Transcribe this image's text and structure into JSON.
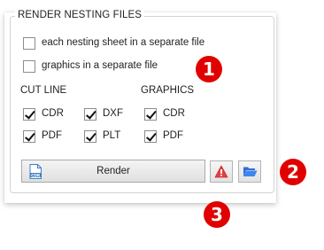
{
  "group": {
    "title": "RENDER NESTING FILES"
  },
  "options": [
    {
      "label": "each nesting sheet in a separate file",
      "checked": false
    },
    {
      "label": "graphics in a separate file",
      "checked": false
    }
  ],
  "cut_line": {
    "heading": "CUT LINE",
    "items": [
      {
        "label": "CDR",
        "checked": true
      },
      {
        "label": "DXF",
        "checked": true
      },
      {
        "label": "PDF",
        "checked": true
      },
      {
        "label": "PLT",
        "checked": true
      }
    ]
  },
  "graphics": {
    "heading": "GRAPHICS",
    "items": [
      {
        "label": "CDR",
        "checked": true
      },
      {
        "label": "PDF",
        "checked": true
      }
    ]
  },
  "buttons": {
    "render_label": "Render",
    "render_icon": "cdr-file-icon",
    "warning_icon": "warning-icon",
    "folder_icon": "folder-open-icon"
  },
  "callouts": [
    "1",
    "2",
    "3"
  ],
  "colors": {
    "callout": "#e00000",
    "warning": "#e04040",
    "folder": "#2e6fd8"
  }
}
